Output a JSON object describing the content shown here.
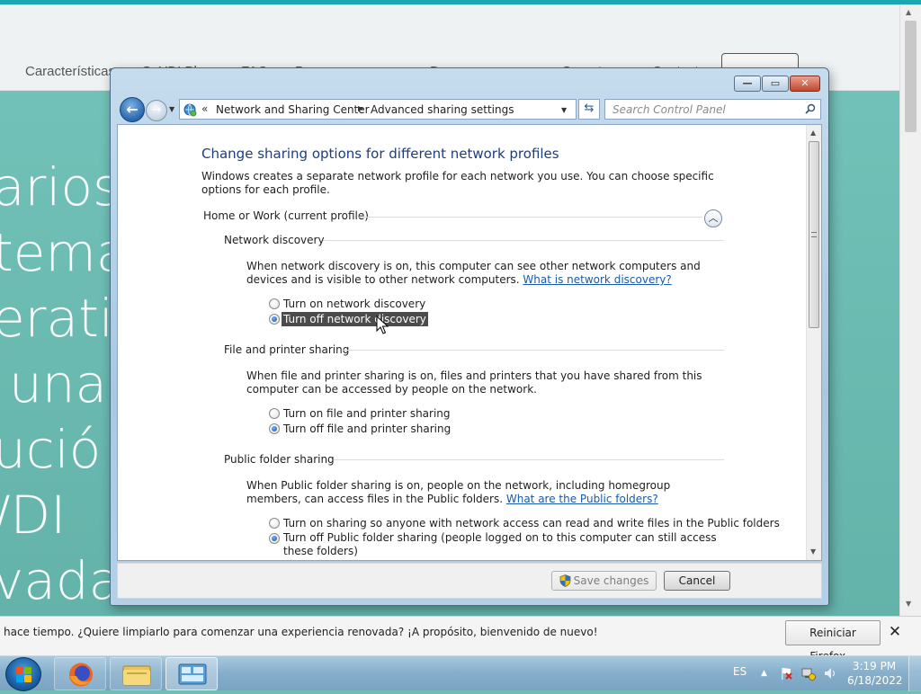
{
  "background_page": {
    "nav": [
      "Características",
      "SoYDI Plus",
      "FAQ",
      "Pr",
      "Descarga",
      "Soporte",
      "Contacto"
    ],
    "hero_lines": [
      "arios",
      "tema",
      "erati",
      "una",
      "ució",
      "/DI",
      "vada"
    ]
  },
  "window": {
    "buttons": {
      "minimize": "—",
      "maximize": "▭",
      "close": "✕"
    },
    "address": {
      "chevron": "«",
      "segments": [
        "Network and Sharing Center",
        "Advanced sharing settings"
      ]
    },
    "search": {
      "placeholder": "Search Control Panel"
    },
    "content": {
      "title": "Change sharing options for different network profiles",
      "description": "Windows creates a separate network profile for each network you use. You can choose specific options for each profile.",
      "profile": {
        "label": "Home or Work (current profile)",
        "collapse_glyph": "︿"
      },
      "sections": {
        "network_discovery": {
          "title": "Network discovery",
          "description": "When network discovery is on, this computer can see other network computers and devices and is visible to other network computers.",
          "link": "What is network discovery?",
          "options": [
            "Turn on network discovery",
            "Turn off network discovery"
          ],
          "selected": 1
        },
        "file_printer": {
          "title": "File and printer sharing",
          "description": "When file and printer sharing is on, files and printers that you have shared from this computer can be accessed by people on the network.",
          "options": [
            "Turn on file and printer sharing",
            "Turn off file and printer sharing"
          ],
          "selected": 1
        },
        "public_folder": {
          "title": "Public folder sharing",
          "description": "When Public folder sharing is on, people on the network, including homegroup members, can access files in the Public folders.",
          "link": "What are the Public folders?",
          "options": [
            "Turn on sharing so anyone with network access can read and write files in the Public folders",
            "Turn off Public folder sharing (people logged on to this computer can still access these folders)"
          ],
          "selected": 1
        }
      }
    },
    "footer": {
      "save": "Save changes",
      "cancel": "Cancel"
    }
  },
  "notification": {
    "text": "hace tiempo. ¿Quiere limpiarlo para comenzar una experiencia renovada? ¡A propósito, bienvenido de nuevo!",
    "button": "Reiniciar Firefox...",
    "close": "✕"
  },
  "taskbar": {
    "language": "ES",
    "tray_arrow": "▲",
    "time": "3:19 PM",
    "date": "6/18/2022"
  }
}
